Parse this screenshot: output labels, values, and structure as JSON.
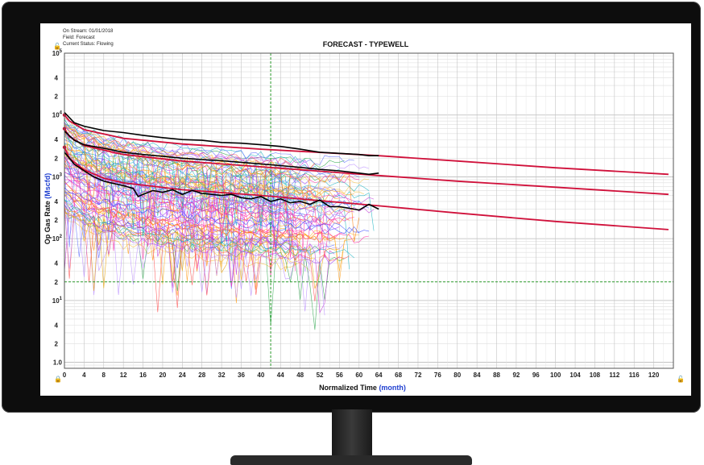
{
  "header": {
    "on_stream": "On Stream: 01/01/2018",
    "field": "Field: Forecast",
    "status": "Current Status: Flowing"
  },
  "icons": {
    "top_left": "green-lock-icon",
    "bottom_left": "red-lock-icon",
    "bottom_right": "green-lock-icon"
  },
  "chart_data": {
    "type": "line",
    "title": "FORECAST - TYPEWELL",
    "xlabel": "Normalized Time",
    "xlabel_unit": "(month)",
    "ylabel": "Op Gas Rate",
    "ylabel_unit": "(Mscfd)",
    "x_range": [
      0,
      124
    ],
    "x_ticks": [
      0,
      4,
      8,
      12,
      16,
      20,
      24,
      28,
      32,
      36,
      40,
      44,
      48,
      52,
      56,
      60,
      64,
      68,
      72,
      76,
      80,
      84,
      88,
      92,
      96,
      100,
      104,
      108,
      112,
      116,
      120
    ],
    "y_scale": "log",
    "y_range": [
      0.8,
      100000
    ],
    "y_major_ticks": [
      {
        "label": "10",
        "exp": "5",
        "value": 100000
      },
      {
        "label": "10",
        "exp": "4",
        "value": 10000
      },
      {
        "label": "10",
        "exp": "3",
        "value": 1000
      },
      {
        "label": "10",
        "exp": "2",
        "value": 100
      },
      {
        "label": "10",
        "exp": "1",
        "value": 10
      },
      {
        "label": "1.0",
        "exp": "",
        "value": 1
      }
    ],
    "y_minor_labels": [
      "2",
      "4"
    ],
    "grid": true,
    "markers": {
      "vertical_line_x": 42,
      "horizontal_line_y": 20,
      "style": "green dashed"
    },
    "colors": {
      "forecast": "#d0103a",
      "typewell": "#000000",
      "marker": "#2a9a2a",
      "axis_unit": "#1f3fd0"
    },
    "forecast_curves": [
      {
        "values": [
          [
            0,
            10000
          ],
          [
            1,
            8000
          ],
          [
            4,
            5800
          ],
          [
            12,
            4200
          ],
          [
            24,
            3400
          ],
          [
            40,
            2800
          ],
          [
            64,
            2200
          ],
          [
            80,
            1800
          ],
          [
            100,
            1400
          ],
          [
            123,
            1100
          ]
        ]
      },
      {
        "values": [
          [
            0,
            6000
          ],
          [
            1,
            4500
          ],
          [
            4,
            3200
          ],
          [
            12,
            2300
          ],
          [
            24,
            1800
          ],
          [
            40,
            1450
          ],
          [
            64,
            1050
          ],
          [
            80,
            850
          ],
          [
            100,
            680
          ],
          [
            123,
            520
          ]
        ]
      },
      {
        "values": [
          [
            0,
            3000
          ],
          [
            1,
            2000
          ],
          [
            4,
            1300
          ],
          [
            8,
            950
          ],
          [
            12,
            800
          ],
          [
            24,
            620
          ],
          [
            40,
            500
          ],
          [
            64,
            340
          ],
          [
            80,
            260
          ],
          [
            100,
            190
          ],
          [
            123,
            140
          ]
        ]
      }
    ],
    "typewell_curves": [
      {
        "values": [
          [
            0,
            11000
          ],
          [
            2,
            7500
          ],
          [
            4,
            6600
          ],
          [
            8,
            5600
          ],
          [
            12,
            5200
          ],
          [
            16,
            4700
          ],
          [
            20,
            4300
          ],
          [
            24,
            4000
          ],
          [
            28,
            3900
          ],
          [
            32,
            3600
          ],
          [
            36,
            3500
          ],
          [
            40,
            3300
          ],
          [
            44,
            3100
          ],
          [
            48,
            2800
          ],
          [
            52,
            2500
          ],
          [
            56,
            2400
          ],
          [
            60,
            2300
          ],
          [
            62,
            2200
          ],
          [
            64,
            2200
          ]
        ]
      },
      {
        "values": [
          [
            0,
            5500
          ],
          [
            2,
            3900
          ],
          [
            4,
            3300
          ],
          [
            8,
            2900
          ],
          [
            12,
            2500
          ],
          [
            16,
            2300
          ],
          [
            20,
            2150
          ],
          [
            24,
            2000
          ],
          [
            28,
            1900
          ],
          [
            32,
            1820
          ],
          [
            36,
            1720
          ],
          [
            40,
            1620
          ],
          [
            44,
            1520
          ],
          [
            48,
            1420
          ],
          [
            52,
            1320
          ],
          [
            56,
            1250
          ],
          [
            60,
            1150
          ],
          [
            62,
            1100
          ],
          [
            64,
            1150
          ]
        ]
      },
      {
        "values": [
          [
            0,
            2500
          ],
          [
            2,
            1600
          ],
          [
            4,
            1250
          ],
          [
            6,
            1000
          ],
          [
            8,
            850
          ],
          [
            10,
            780
          ],
          [
            12,
            720
          ],
          [
            14,
            650
          ],
          [
            15,
            480
          ],
          [
            16,
            520
          ],
          [
            18,
            600
          ],
          [
            20,
            560
          ],
          [
            22,
            620
          ],
          [
            24,
            520
          ],
          [
            26,
            600
          ],
          [
            28,
            540
          ],
          [
            30,
            520
          ],
          [
            32,
            500
          ],
          [
            34,
            520
          ],
          [
            36,
            460
          ],
          [
            38,
            440
          ],
          [
            40,
            480
          ],
          [
            42,
            400
          ],
          [
            44,
            440
          ],
          [
            46,
            380
          ],
          [
            48,
            400
          ],
          [
            50,
            360
          ],
          [
            52,
            420
          ],
          [
            54,
            330
          ],
          [
            56,
            330
          ],
          [
            58,
            310
          ],
          [
            60,
            290
          ],
          [
            62,
            360
          ],
          [
            64,
            300
          ]
        ]
      }
    ]
  }
}
